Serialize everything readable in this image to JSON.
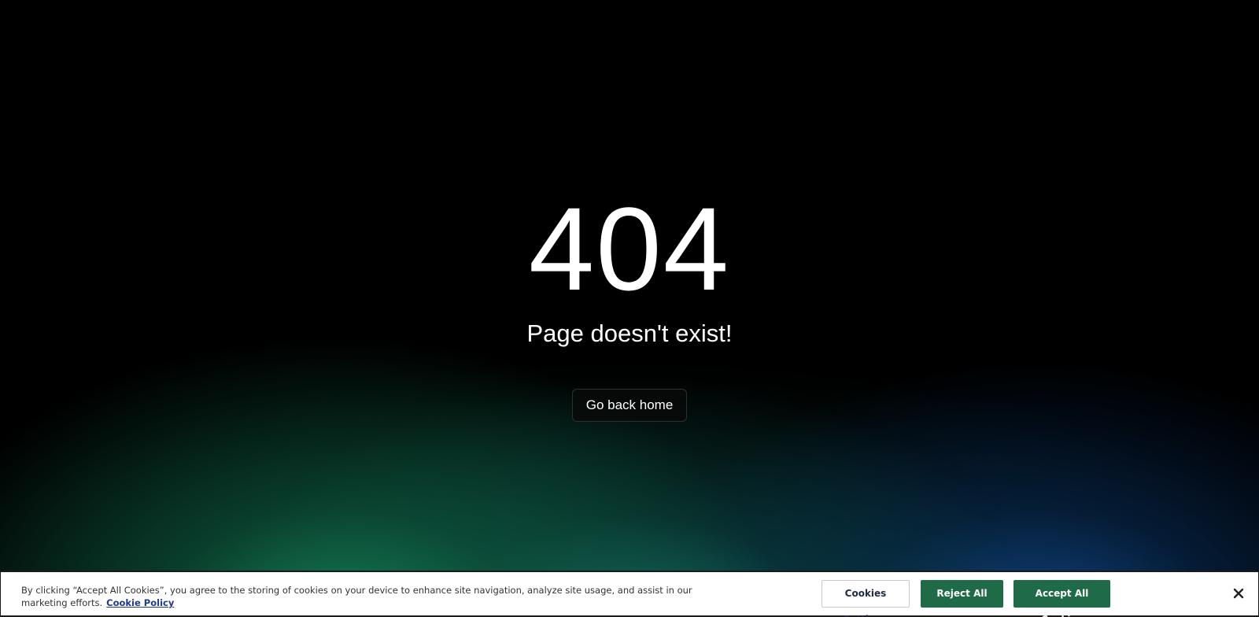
{
  "error_page": {
    "code": "404",
    "message": "Page doesn't exist!",
    "home_button_label": "Go back home"
  },
  "cookie_banner": {
    "text": "By clicking “Accept All Cookies”, you agree to the storing of cookies on your device to enhance site navigation, analyze site usage, and assist in our marketing efforts.",
    "policy_link": "Cookie Policy",
    "settings_button": "Cookies Settings",
    "reject_button": "Reject All",
    "accept_button": "Accept All Cookies",
    "close_icon": "close-icon"
  },
  "colors": {
    "background": "#000000",
    "button_green": "#1f6b47",
    "link_blue": "#1f3a8a"
  }
}
